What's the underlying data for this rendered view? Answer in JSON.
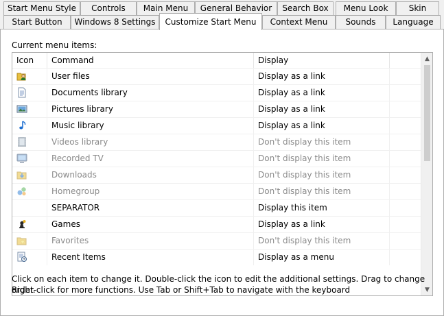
{
  "tabs_row1": [
    {
      "label": "Start Menu Style"
    },
    {
      "label": "Controls"
    },
    {
      "label": "Main Menu"
    },
    {
      "label": "General Behavior"
    },
    {
      "label": "Search Box"
    },
    {
      "label": "Menu Look"
    },
    {
      "label": "Skin"
    }
  ],
  "tabs_row2": [
    {
      "label": "Start Button"
    },
    {
      "label": "Windows 8 Settings"
    },
    {
      "label": "Customize Start Menu",
      "active": true
    },
    {
      "label": "Context Menu"
    },
    {
      "label": "Sounds"
    },
    {
      "label": "Language"
    }
  ],
  "list": {
    "label": "Current menu items:",
    "columns": {
      "icon": "Icon",
      "command": "Command",
      "display": "Display"
    },
    "rows": [
      {
        "icon": "user-files-icon",
        "command": "User files",
        "display": "Display as a link",
        "enabled": true
      },
      {
        "icon": "documents-icon",
        "command": "Documents library",
        "display": "Display as a link",
        "enabled": true
      },
      {
        "icon": "pictures-icon",
        "command": "Pictures library",
        "display": "Display as a link",
        "enabled": true
      },
      {
        "icon": "music-icon",
        "command": "Music library",
        "display": "Display as a link",
        "enabled": true
      },
      {
        "icon": "videos-icon",
        "command": "Videos library",
        "display": "Don't display this item",
        "enabled": false
      },
      {
        "icon": "recorded-tv-icon",
        "command": "Recorded TV",
        "display": "Don't display this item",
        "enabled": false
      },
      {
        "icon": "downloads-icon",
        "command": "Downloads",
        "display": "Don't display this item",
        "enabled": false
      },
      {
        "icon": "homegroup-icon",
        "command": "Homegroup",
        "display": "Don't display this item",
        "enabled": false
      },
      {
        "icon": "",
        "command": "SEPARATOR",
        "display": "Display this item",
        "enabled": true
      },
      {
        "icon": "games-icon",
        "command": "Games",
        "display": "Display as a link",
        "enabled": true
      },
      {
        "icon": "favorites-icon",
        "command": "Favorites",
        "display": "Don't display this item",
        "enabled": false
      },
      {
        "icon": "recent-items-icon",
        "command": "Recent Items",
        "display": "Display as a menu",
        "enabled": true
      }
    ]
  },
  "help": {
    "line1": "Click on each item to change it. Double-click the icon to edit the additional settings. Drag to change order.",
    "line2": "Right-click for more functions. Use Tab or Shift+Tab to navigate with the keyboard"
  },
  "colors": {
    "disabled_text": "#8a8a8a",
    "border": "#adadad",
    "background": "#f0f0f0"
  }
}
